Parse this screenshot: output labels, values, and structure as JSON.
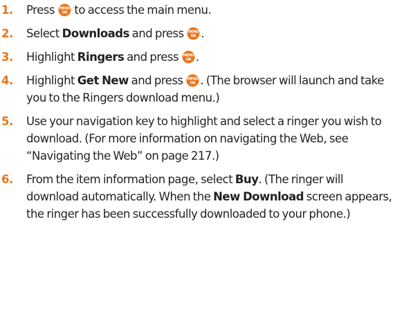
{
  "key_icon": {
    "name": "menu-ok-key-icon",
    "line1": "MENU",
    "line2": "OK",
    "color": "#e8751a"
  },
  "steps": [
    {
      "number": "1.",
      "parts": [
        {
          "t": "Press "
        },
        {
          "icon": true
        },
        {
          "t": " to access the main menu."
        }
      ]
    },
    {
      "number": "2.",
      "parts": [
        {
          "t": "Select "
        },
        {
          "t": "Downloads",
          "b": true
        },
        {
          "t": " and press "
        },
        {
          "icon": true
        },
        {
          "t": "."
        }
      ]
    },
    {
      "number": "3.",
      "parts": [
        {
          "t": "Highlight "
        },
        {
          "t": "Ringers",
          "b": true
        },
        {
          "t": " and press "
        },
        {
          "icon": true
        },
        {
          "t": "."
        }
      ]
    },
    {
      "number": "4.",
      "parts": [
        {
          "t": "Highlight "
        },
        {
          "t": "Get New",
          "b": true
        },
        {
          "t": " and press "
        },
        {
          "icon": true
        },
        {
          "t": ". (The browser will launch and take you to the Ringers download menu.)"
        }
      ]
    },
    {
      "number": "5.",
      "parts": [
        {
          "t": "Use your navigation key to highlight and select a ringer you wish to download. (For more information on navigating the Web, see “Navigating the Web” on page 217.)"
        }
      ]
    },
    {
      "number": "6.",
      "parts": [
        {
          "t": "From the item information page, select "
        },
        {
          "t": "Buy",
          "b": true
        },
        {
          "t": ". (The ringer will download automatically. When the "
        },
        {
          "t": "New Download",
          "b": true
        },
        {
          "t": " screen appears, the ringer has been successfully downloaded to your phone.)"
        }
      ]
    }
  ]
}
